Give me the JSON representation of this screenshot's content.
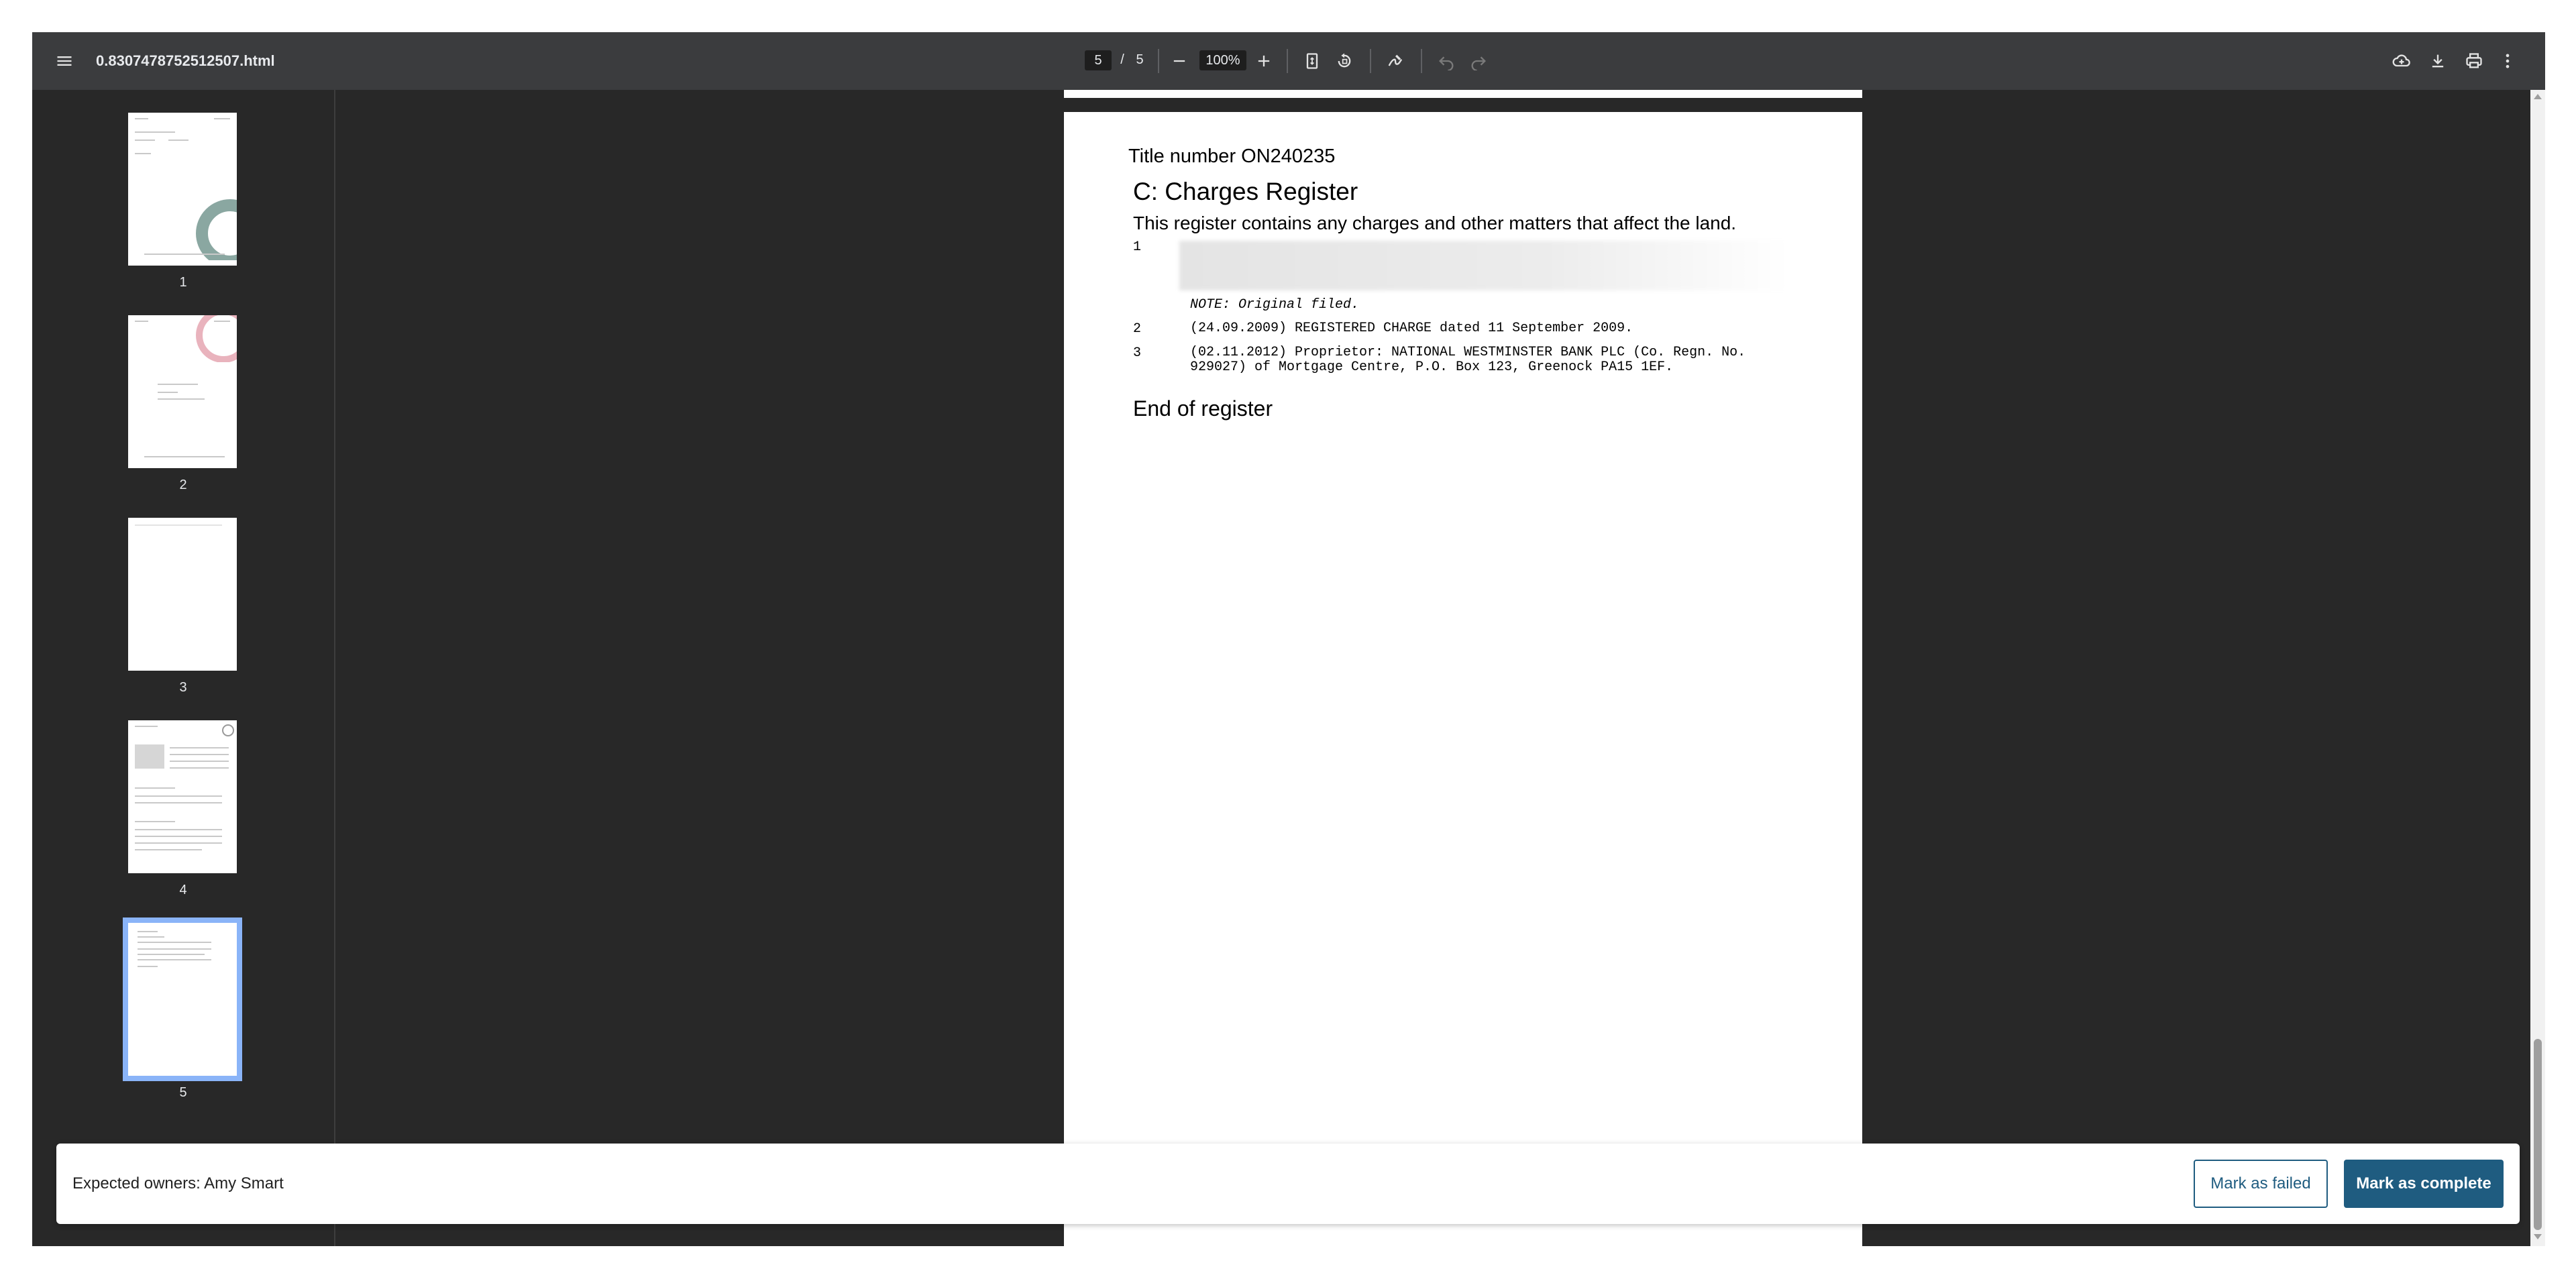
{
  "toolbar": {
    "file_name": "0.8307478752512507.html",
    "current_page": "5",
    "page_separator": "/",
    "total_pages": "5",
    "zoom": "100%",
    "icons": [
      "menu-icon",
      "zoom-out-icon",
      "zoom-in-icon",
      "fit-page-icon",
      "rotate-icon",
      "annotate-icon",
      "undo-icon",
      "redo-icon",
      "drive-icon",
      "download-icon",
      "print-icon",
      "more-icon"
    ]
  },
  "sidebar": {
    "thumbnails": [
      {
        "label": "1"
      },
      {
        "label": "2"
      },
      {
        "label": "3"
      },
      {
        "label": "4"
      },
      {
        "label": "5",
        "selected": true
      }
    ]
  },
  "document": {
    "title_number": "Title number ON240235",
    "register_heading": "C: Charges Register",
    "register_description": "This register contains any charges and other matters that affect the land.",
    "entries": [
      {
        "num": "1",
        "text": "",
        "note": "NOTE: Original filed."
      },
      {
        "num": "2",
        "text": "(24.09.2009) REGISTERED CHARGE dated 11 September 2009."
      },
      {
        "num": "3",
        "text": "(02.11.2012) Proprietor: NATIONAL WESTMINSTER BANK PLC (Co. Regn. No.\n929027) of Mortgage Centre, P.O. Box 123, Greenock PA15 1EF."
      }
    ],
    "end_text": "End of register"
  },
  "review_bar": {
    "expected_owners": "Expected owners: Amy Smart",
    "mark_failed_label": "Mark as failed",
    "mark_complete_label": "Mark as complete"
  },
  "colors": {
    "toolbar_bg": "#3b3c3e",
    "viewer_bg": "#282828",
    "accent": "#1f5c80",
    "selection": "#8ab4f8"
  }
}
